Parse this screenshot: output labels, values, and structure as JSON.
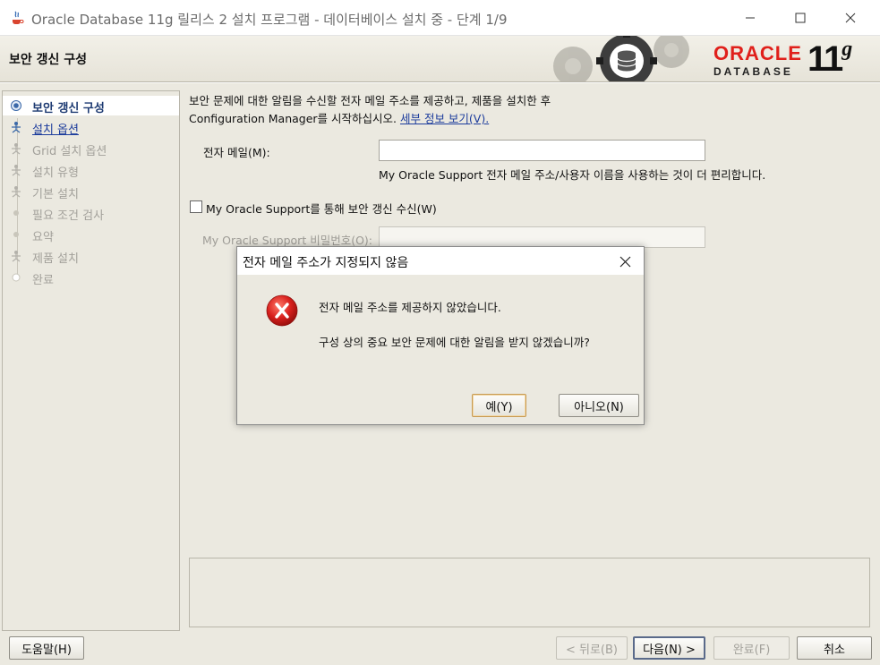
{
  "window": {
    "title": "Oracle Database 11g 릴리스 2 설치 프로그램 - 데이터베이스 설치 중 - 단계 1/9"
  },
  "banner": {
    "heading": "보안 갱신 구성",
    "logo_brand": "ORACLE",
    "logo_product": "DATABASE",
    "logo_version": "11",
    "logo_version_suffix": "g"
  },
  "steps": [
    {
      "label": "보안 갱신 구성",
      "state": "active"
    },
    {
      "label": "설치 옵션",
      "state": "link"
    },
    {
      "label": "Grid 설치 옵션",
      "state": "disabled"
    },
    {
      "label": "설치 유형",
      "state": "disabled"
    },
    {
      "label": "기본 설치",
      "state": "disabled"
    },
    {
      "label": "필요 조건 검사",
      "state": "disabled"
    },
    {
      "label": "요약",
      "state": "disabled"
    },
    {
      "label": "제품 설치",
      "state": "disabled"
    },
    {
      "label": "완료",
      "state": "disabled"
    }
  ],
  "content": {
    "intro_line1": "보안 문제에 대한 알림을 수신할 전자 메일 주소를 제공하고, 제품을 설치한 후",
    "intro_line2": "Configuration Manager를 시작하십시오.",
    "details_link": "세부 정보 보기(V).",
    "email_label": "전자 메일(M):",
    "email_value": "",
    "email_hint": "My Oracle Support 전자 메일 주소/사용자 이름을 사용하는 것이 더 편리합니다.",
    "receive_checkbox_label": "My Oracle Support를 통해 보안 갱신 수신(W)",
    "receive_checked": false,
    "password_label": "My Oracle Support 비밀번호(O):",
    "password_value": ""
  },
  "buttons": {
    "help": "도움말(H)",
    "back": "< 뒤로(B)",
    "next": "다음(N) >",
    "finish": "완료(F)",
    "cancel": "취소"
  },
  "dialog": {
    "title": "전자 메일 주소가 지정되지 않음",
    "message1": "전자 메일 주소를 제공하지 않았습니다.",
    "message2": "구성 상의 중요 보안 문제에 대한 알림을 받지 않겠습니까?",
    "yes": "예(Y)",
    "no": "아니오(N)"
  },
  "colors": {
    "oracle_red": "#e0201b",
    "link_blue": "#1c3c9c",
    "panel_bg": "#ebe9e0",
    "error_red": "#d8201d"
  }
}
